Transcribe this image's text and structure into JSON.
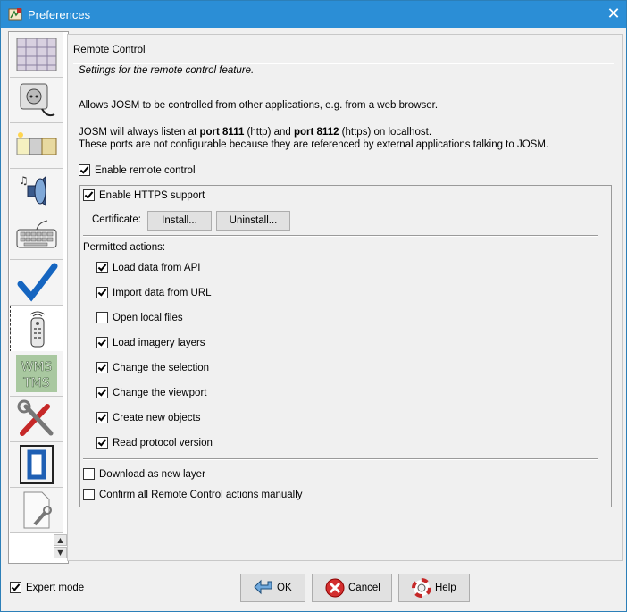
{
  "window": {
    "title": "Preferences",
    "close_symbol": "✕"
  },
  "sidebar": {
    "tabs": [
      {
        "icon": "map-grid-icon"
      },
      {
        "icon": "plug-icon"
      },
      {
        "icon": "folders-icon"
      },
      {
        "icon": "sound-icon"
      },
      {
        "icon": "keyboard-icon"
      },
      {
        "icon": "checkmark-icon"
      },
      {
        "icon": "remote-control-icon",
        "selected": true
      },
      {
        "icon": "wms-tms-icon",
        "label_line1": "WMS",
        "label_line2": "TMS"
      },
      {
        "icon": "tools-icon"
      },
      {
        "icon": "node-icon"
      },
      {
        "icon": "document-wrench-icon"
      }
    ],
    "scroll_up": "▲",
    "scroll_down": "▼"
  },
  "panel": {
    "title": "Remote Control",
    "subtitle": "Settings for the remote control feature.",
    "description": "Allows JOSM to be controlled from other applications, e.g. from a web browser.",
    "ports_prefix": "JOSM will always listen at ",
    "port_http": "port 8111",
    "ports_mid": " (http) and ",
    "port_https": "port 8112",
    "ports_suffix": " (https) on localhost.",
    "ports_note": "These ports are not configurable because they are referenced by external applications talking to JOSM.",
    "enable_remote_control": {
      "label": "Enable remote control",
      "checked": true
    },
    "enable_https": {
      "label": "Enable HTTPS support",
      "checked": true
    },
    "certificate_label": "Certificate:",
    "install_button": "Install...",
    "uninstall_button": "Uninstall...",
    "permitted_actions_label": "Permitted actions:",
    "actions": [
      {
        "label": "Load data from API",
        "checked": true
      },
      {
        "label": "Import data from URL",
        "checked": true
      },
      {
        "label": "Open local files",
        "checked": false
      },
      {
        "label": "Load imagery layers",
        "checked": true
      },
      {
        "label": "Change the selection",
        "checked": true
      },
      {
        "label": "Change the viewport",
        "checked": true
      },
      {
        "label": "Create new objects",
        "checked": true
      },
      {
        "label": "Read protocol version",
        "checked": true
      }
    ],
    "download_new_layer": {
      "label": "Download as new layer",
      "checked": false
    },
    "confirm_all": {
      "label": "Confirm all Remote Control actions manually",
      "checked": false
    }
  },
  "footer": {
    "expert_mode": {
      "label": "Expert mode",
      "checked": true
    },
    "ok_button": "OK",
    "cancel_button": "Cancel",
    "help_button": "Help"
  },
  "colors": {
    "titlebar": "#2b8ed6",
    "background": "#f0f0f0"
  }
}
